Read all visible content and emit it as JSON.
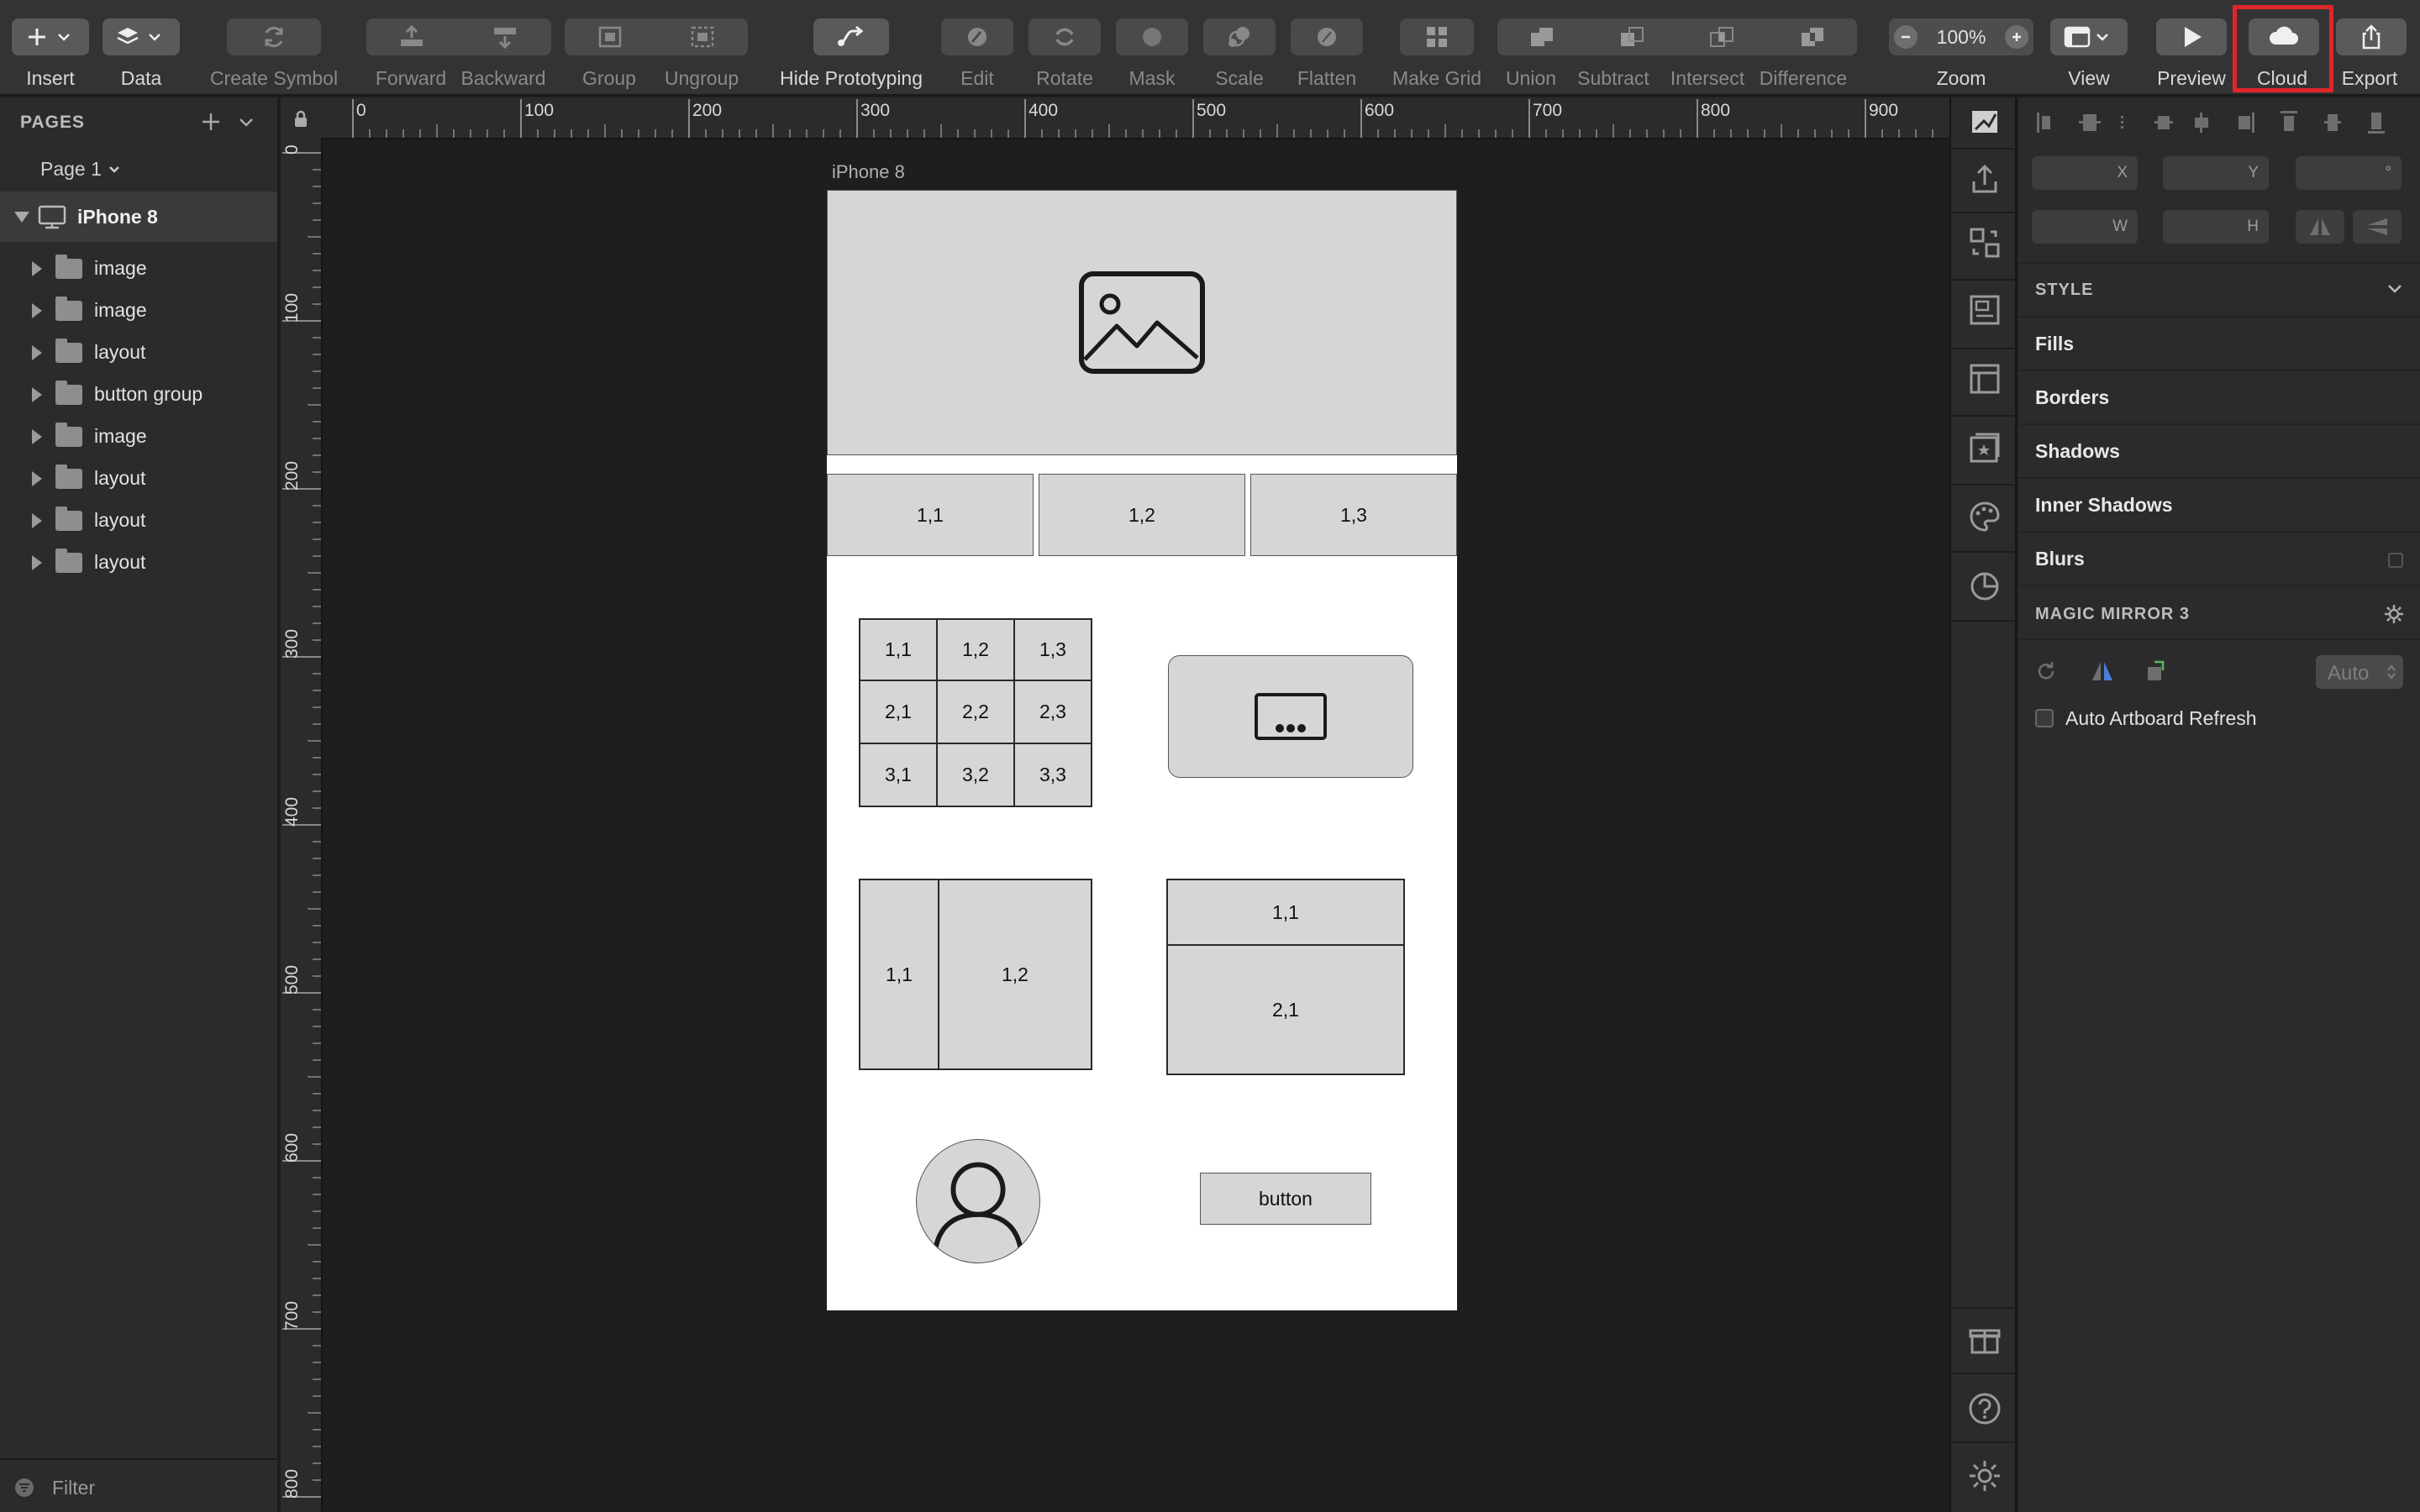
{
  "toolbar": {
    "insert": "Insert",
    "data": "Data",
    "create_symbol": "Create Symbol",
    "forward": "Forward",
    "backward": "Backward",
    "group": "Group",
    "ungroup": "Ungroup",
    "hide_prototyping": "Hide Prototyping",
    "edit": "Edit",
    "rotate": "Rotate",
    "mask": "Mask",
    "scale": "Scale",
    "flatten": "Flatten",
    "make_grid": "Make Grid",
    "union": "Union",
    "subtract": "Subtract",
    "intersect": "Intersect",
    "difference": "Difference",
    "zoom_value": "100%",
    "zoom": "Zoom",
    "view": "View",
    "preview": "Preview",
    "cloud": "Cloud",
    "export": "Export"
  },
  "left_panel": {
    "pages_title": "PAGES",
    "current_page": "Page 1",
    "artboard": "iPhone 8",
    "layers": [
      "image",
      "image",
      "layout",
      "button group",
      "image",
      "layout",
      "layout",
      "layout"
    ],
    "filter": "Filter"
  },
  "rulers": {
    "top": [
      "0",
      "100",
      "200",
      "300",
      "400",
      "500",
      "600",
      "700",
      "800",
      "900"
    ],
    "left": [
      "0",
      "100",
      "200",
      "300",
      "400",
      "500",
      "600",
      "700",
      "800"
    ]
  },
  "artboard": {
    "title": "iPhone 8",
    "tabs": [
      "1,1",
      "1,2",
      "1,3"
    ],
    "grid3": [
      "1,1",
      "1,2",
      "1,3",
      "2,1",
      "2,2",
      "2,3",
      "3,1",
      "3,2",
      "3,3"
    ],
    "cols2": [
      "1,1",
      "1,2"
    ],
    "rows2": [
      "1,1",
      "2,1"
    ],
    "button": "button"
  },
  "inspector": {
    "x": "X",
    "y": "Y",
    "deg": "°",
    "w": "W",
    "h": "H",
    "style": "STYLE",
    "fills": "Fills",
    "borders": "Borders",
    "shadows": "Shadows",
    "inner_shadows": "Inner Shadows",
    "blurs": "Blurs",
    "magic_mirror": "MAGIC MIRROR 3",
    "auto": "Auto",
    "auto_refresh": "Auto Artboard Refresh"
  },
  "colors": {
    "toolbar_bg": "#333335",
    "panel_bg": "#2b2b2d",
    "canvas_bg": "#1e1e1f",
    "highlight": "#e0262a",
    "placeholder_fill": "#d6d6d6"
  }
}
